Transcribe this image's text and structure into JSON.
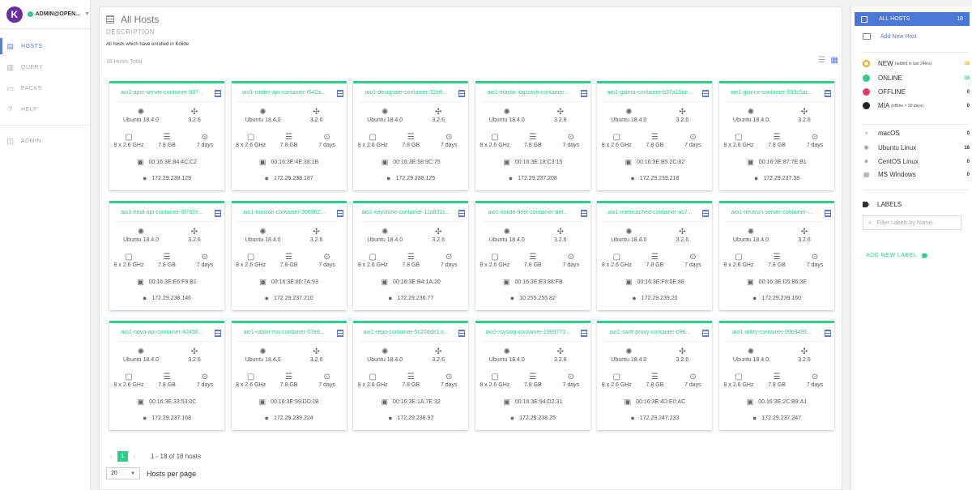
{
  "user": {
    "name": "ADMIN@OPEN..."
  },
  "nav": [
    {
      "label": "HOSTS",
      "icon": "hosts-icon",
      "active": true
    },
    {
      "label": "QUERY",
      "icon": "query-icon",
      "active": false
    },
    {
      "label": "PACKS",
      "icon": "packs-icon",
      "active": false
    },
    {
      "label": "HELP",
      "icon": "help-icon",
      "active": false
    },
    {
      "label": "ADMIN",
      "icon": "admin-icon",
      "active": false
    }
  ],
  "page": {
    "title": "All Hosts",
    "description_label": "DESCRIPTION",
    "description": "All hosts which have enrolled in Kolide",
    "hosts_total": "18 Hosts Total"
  },
  "hosts": [
    {
      "name": "aio1-apm-server-container-607...",
      "os": "Ubuntu 18.4.0",
      "version": "3.2.6",
      "cpu": "8 x 2.6 GHz",
      "memory": "7.8 GB",
      "uptime": "7 days",
      "mac": "00:16:3E:84:4C:C2",
      "ip": "172.29.238.129"
    },
    {
      "name": "aio1-cinder-api-container-f642a...",
      "os": "Ubuntu 18.4.0",
      "version": "3.2.6",
      "cpu": "8 x 2.6 GHz",
      "memory": "7.8 GB",
      "uptime": "7 days",
      "mac": "00:16:3E:4E:38:1B",
      "ip": "172.29.238.187"
    },
    {
      "name": "aio1-designate-container-32eff...",
      "os": "Ubuntu 18.4.0",
      "version": "3.2.6",
      "cpu": "8 x 2.6 GHz",
      "memory": "7.8 GB",
      "uptime": "7 days",
      "mac": "00:16:3E:58:9C:75",
      "ip": "172.29.238.125"
    },
    {
      "name": "aio1-elastic-logstash-container...",
      "os": "Ubuntu 18.4.0",
      "version": "3.2.6",
      "cpu": "8 x 2.6 GHz",
      "memory": "7.8 GB",
      "uptime": "7 days",
      "mac": "00:16:3E:18:C3:15",
      "ip": "172.29.237.208"
    },
    {
      "name": "aio1-galera-container-b37a15ae...",
      "os": "Ubuntu 18.4.0",
      "version": "3.2.6",
      "cpu": "8 x 2.6 GHz",
      "memory": "7.8 GB",
      "uptime": "7 days",
      "mac": "00:16:3E:B5:2C:82",
      "ip": "172.29.239.218"
    },
    {
      "name": "aio1-glance-container-593c5ac...",
      "os": "Ubuntu 18.4.0",
      "version": "3.2.6",
      "cpu": "8 x 2.6 GHz",
      "memory": "7.8 GB",
      "uptime": "7 days",
      "mac": "00:16:3E:87:7E:B1",
      "ip": "172.29.237.38"
    },
    {
      "name": "aio1-heat-api-container-0f7d2e...",
      "os": "Ubuntu 18.4.0",
      "version": "3.2.6",
      "cpu": "8 x 2.6 GHz",
      "memory": "7.8 GB",
      "uptime": "7 days",
      "mac": "00:16:3E:E6:F9:B1",
      "ip": "172.29.238.146"
    },
    {
      "name": "aio1-horizon-container-306962...",
      "os": "Ubuntu 18.4.0",
      "version": "3.2.6",
      "cpu": "8 x 2.6 GHz",
      "memory": "7.8 GB",
      "uptime": "7 days",
      "mac": "00:16:3E:80:7A:93",
      "ip": "172.29.237.210"
    },
    {
      "name": "aio1-keystone-container-11a831c...",
      "os": "Ubuntu 18.4.0",
      "version": "3.2.6",
      "cpu": "8 x 2.6 GHz",
      "memory": "7.8 GB",
      "uptime": "7 days",
      "mac": "00:16:3E:B4:1A:20",
      "ip": "172.29.236.77"
    },
    {
      "name": "aio1-kolide-fleet-container-bef...",
      "os": "Ubuntu 18.4.0",
      "version": "3.2.6",
      "cpu": "8 x 2.6 GHz",
      "memory": "7.8 GB",
      "uptime": "7 days",
      "mac": "00:16:3E:E3:88:FB",
      "ip": "10.255.255.82"
    },
    {
      "name": "aio1-memcached-container-ac7...",
      "os": "Ubuntu 18.4.0",
      "version": "3.2.6",
      "cpu": "8 x 2.6 GHz",
      "memory": "7.8 GB",
      "uptime": "7 days",
      "mac": "00:16:3E:F8:0E:88",
      "ip": "172.29.239.20"
    },
    {
      "name": "aio1-neutron-server-container-...",
      "os": "Ubuntu 18.4.0",
      "version": "3.2.6",
      "cpu": "8 x 2.6 GHz",
      "memory": "7.8 GB",
      "uptime": "7 days",
      "mac": "00:16:3E:D5:86:3E",
      "ip": "172.29.239.160"
    },
    {
      "name": "aio1-nova-api-container-42456...",
      "os": "Ubuntu 18.4.0",
      "version": "3.2.6",
      "cpu": "8 x 2.6 GHz",
      "memory": "7.8 GB",
      "uptime": "7 days",
      "mac": "00:16:3E:33:53:0C",
      "ip": "172.29.237.168"
    },
    {
      "name": "aio1-rabbit-mq-container-57e8...",
      "os": "Ubuntu 18.4.0",
      "version": "3.2.6",
      "cpu": "8 x 2.6 GHz",
      "memory": "7.8 GB",
      "uptime": "7 days",
      "mac": "00:16:3E:99:DD:08",
      "ip": "172.29.239.224"
    },
    {
      "name": "aio1-repo-container-5c20dde1.o...",
      "os": "Ubuntu 18.4.0",
      "version": "3.2.6",
      "cpu": "8 x 2.6 GHz",
      "memory": "7.8 GB",
      "uptime": "7 days",
      "mac": "00:16:3E:1A:7E:32",
      "ip": "172.29.238.97"
    },
    {
      "name": "aio1-rsyslog-container-1989773...",
      "os": "Ubuntu 18.4.0",
      "version": "3.2.6",
      "cpu": "8 x 2.6 GHz",
      "memory": "7.8 GB",
      "uptime": "7 days",
      "mac": "00:16:3E:94:D2:31",
      "ip": "172.29.238.25"
    },
    {
      "name": "aio1-swift-proxy-container-b96...",
      "os": "Ubuntu 18.4.0",
      "version": "3.2.6",
      "cpu": "8 x 2.6 GHz",
      "memory": "7.8 GB",
      "uptime": "7 days",
      "mac": "00:16:3E:4D:E0:AC",
      "ip": "172.29.247.233"
    },
    {
      "name": "aio1-utility-container-99b9498...",
      "os": "Ubuntu 18.4.0",
      "version": "3.2.6",
      "cpu": "8 x 2.6 GHz",
      "memory": "7.8 GB",
      "uptime": "7 days",
      "mac": "00:16:3E:2C:B9:A1",
      "ip": "172.29.237.247"
    }
  ],
  "pagination": {
    "page": "1",
    "range": "1 - 18 of 18 hosts",
    "per_page": "20",
    "per_page_label": "Hosts per page"
  },
  "sidebar": {
    "all_hosts": {
      "label": "ALL HOSTS",
      "count": "18"
    },
    "add_host": "Add New Host",
    "statuses": [
      {
        "label": "NEW",
        "sub": "(added in last 24hrs)",
        "count": "18",
        "color": "#f5a623",
        "icon": "new-status-icon"
      },
      {
        "label": "ONLINE",
        "sub": "",
        "count": "18",
        "color": "#2fce8d",
        "icon": "online-status-icon"
      },
      {
        "label": "OFFLINE",
        "sub": "",
        "count": "0",
        "color": "#e8386b",
        "icon": "offline-status-icon"
      },
      {
        "label": "MIA",
        "sub": "(offline > 30 days)",
        "count": "0",
        "color": "#222222",
        "icon": "mia-status-icon"
      }
    ],
    "platforms": [
      {
        "label": "macOS",
        "count": "0",
        "icon": "apple-icon"
      },
      {
        "label": "Ubuntu Linux",
        "count": "18",
        "icon": "ubuntu-icon"
      },
      {
        "label": "CentOS Linux",
        "count": "0",
        "icon": "centos-icon"
      },
      {
        "label": "MS Windows",
        "count": "0",
        "icon": "windows-icon"
      }
    ],
    "labels_title": "LABELS",
    "filter_placeholder": "Filter Labels by Name...",
    "add_label": "ADD NEW LABEL"
  }
}
